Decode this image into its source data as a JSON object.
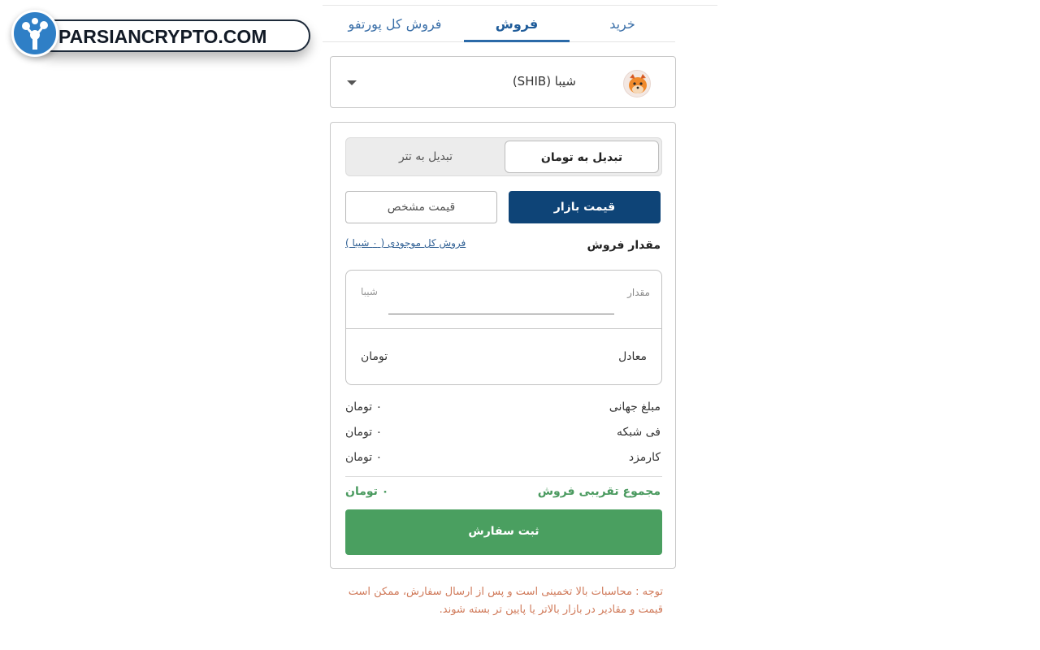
{
  "watermark": {
    "text": "PARSIANCRYPTO.COM"
  },
  "tabs": [
    {
      "label": "خرید"
    },
    {
      "label": "فروش"
    },
    {
      "label": "فروش کل پورتفو"
    }
  ],
  "coin": {
    "name": "شیبا (SHIB)",
    "icon": "shiba-inu-icon"
  },
  "convert": {
    "toman": "تبدیل به تومان",
    "tether": "تبدیل به تتر"
  },
  "price_mode": {
    "market": "قیمت بازار",
    "limit": "قیمت مشخص"
  },
  "amount": {
    "label": "مقدار فروش",
    "sell_all": "فروش کل موجودی ( ۰ شیبا )",
    "input_label": "مقدار",
    "input_unit": "شیبا",
    "equivalent_label": "معادل",
    "equivalent_unit": "تومان"
  },
  "summary": [
    {
      "label": "مبلغ جهانی",
      "value": "۰ تومان"
    },
    {
      "label": "فی شبکه",
      "value": "۰ تومان"
    },
    {
      "label": "کارمزد",
      "value": "۰ تومان"
    }
  ],
  "total": {
    "label": "مجموع تقریبی فروش",
    "value": "۰ تومان"
  },
  "submit_label": "ثبت سفارش",
  "note": "توجه : محاسبات بالا تخمینی است و پس از ارسال سفارش، ممکن است قیمت و مقادیر در بازار بالاتر یا پایین تر بسته شوند.",
  "colors": {
    "primary": "#0e4477",
    "success": "#4a9f60",
    "note": "#d07a5a",
    "tab_active": "#2b6aa8"
  }
}
